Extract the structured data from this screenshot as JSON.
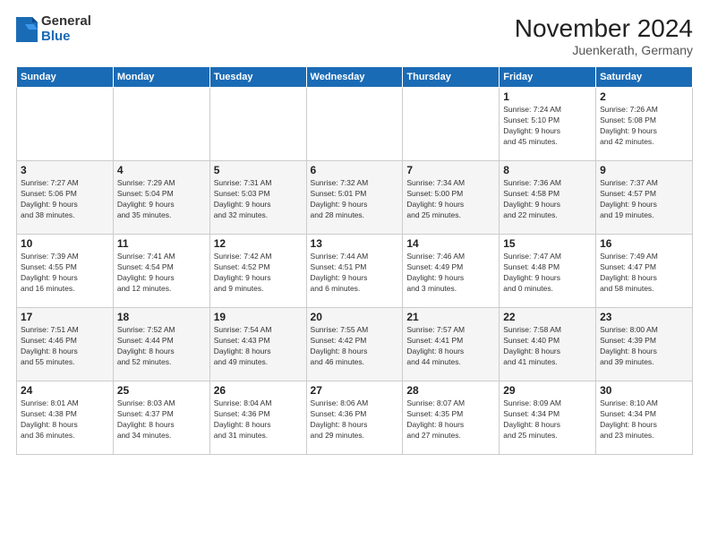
{
  "logo": {
    "general": "General",
    "blue": "Blue"
  },
  "title": "November 2024",
  "location": "Juenkerath, Germany",
  "days_of_week": [
    "Sunday",
    "Monday",
    "Tuesday",
    "Wednesday",
    "Thursday",
    "Friday",
    "Saturday"
  ],
  "weeks": [
    [
      {
        "day": "",
        "info": ""
      },
      {
        "day": "",
        "info": ""
      },
      {
        "day": "",
        "info": ""
      },
      {
        "day": "",
        "info": ""
      },
      {
        "day": "",
        "info": ""
      },
      {
        "day": "1",
        "info": "Sunrise: 7:24 AM\nSunset: 5:10 PM\nDaylight: 9 hours\nand 45 minutes."
      },
      {
        "day": "2",
        "info": "Sunrise: 7:26 AM\nSunset: 5:08 PM\nDaylight: 9 hours\nand 42 minutes."
      }
    ],
    [
      {
        "day": "3",
        "info": "Sunrise: 7:27 AM\nSunset: 5:06 PM\nDaylight: 9 hours\nand 38 minutes."
      },
      {
        "day": "4",
        "info": "Sunrise: 7:29 AM\nSunset: 5:04 PM\nDaylight: 9 hours\nand 35 minutes."
      },
      {
        "day": "5",
        "info": "Sunrise: 7:31 AM\nSunset: 5:03 PM\nDaylight: 9 hours\nand 32 minutes."
      },
      {
        "day": "6",
        "info": "Sunrise: 7:32 AM\nSunset: 5:01 PM\nDaylight: 9 hours\nand 28 minutes."
      },
      {
        "day": "7",
        "info": "Sunrise: 7:34 AM\nSunset: 5:00 PM\nDaylight: 9 hours\nand 25 minutes."
      },
      {
        "day": "8",
        "info": "Sunrise: 7:36 AM\nSunset: 4:58 PM\nDaylight: 9 hours\nand 22 minutes."
      },
      {
        "day": "9",
        "info": "Sunrise: 7:37 AM\nSunset: 4:57 PM\nDaylight: 9 hours\nand 19 minutes."
      }
    ],
    [
      {
        "day": "10",
        "info": "Sunrise: 7:39 AM\nSunset: 4:55 PM\nDaylight: 9 hours\nand 16 minutes."
      },
      {
        "day": "11",
        "info": "Sunrise: 7:41 AM\nSunset: 4:54 PM\nDaylight: 9 hours\nand 12 minutes."
      },
      {
        "day": "12",
        "info": "Sunrise: 7:42 AM\nSunset: 4:52 PM\nDaylight: 9 hours\nand 9 minutes."
      },
      {
        "day": "13",
        "info": "Sunrise: 7:44 AM\nSunset: 4:51 PM\nDaylight: 9 hours\nand 6 minutes."
      },
      {
        "day": "14",
        "info": "Sunrise: 7:46 AM\nSunset: 4:49 PM\nDaylight: 9 hours\nand 3 minutes."
      },
      {
        "day": "15",
        "info": "Sunrise: 7:47 AM\nSunset: 4:48 PM\nDaylight: 9 hours\nand 0 minutes."
      },
      {
        "day": "16",
        "info": "Sunrise: 7:49 AM\nSunset: 4:47 PM\nDaylight: 8 hours\nand 58 minutes."
      }
    ],
    [
      {
        "day": "17",
        "info": "Sunrise: 7:51 AM\nSunset: 4:46 PM\nDaylight: 8 hours\nand 55 minutes."
      },
      {
        "day": "18",
        "info": "Sunrise: 7:52 AM\nSunset: 4:44 PM\nDaylight: 8 hours\nand 52 minutes."
      },
      {
        "day": "19",
        "info": "Sunrise: 7:54 AM\nSunset: 4:43 PM\nDaylight: 8 hours\nand 49 minutes."
      },
      {
        "day": "20",
        "info": "Sunrise: 7:55 AM\nSunset: 4:42 PM\nDaylight: 8 hours\nand 46 minutes."
      },
      {
        "day": "21",
        "info": "Sunrise: 7:57 AM\nSunset: 4:41 PM\nDaylight: 8 hours\nand 44 minutes."
      },
      {
        "day": "22",
        "info": "Sunrise: 7:58 AM\nSunset: 4:40 PM\nDaylight: 8 hours\nand 41 minutes."
      },
      {
        "day": "23",
        "info": "Sunrise: 8:00 AM\nSunset: 4:39 PM\nDaylight: 8 hours\nand 39 minutes."
      }
    ],
    [
      {
        "day": "24",
        "info": "Sunrise: 8:01 AM\nSunset: 4:38 PM\nDaylight: 8 hours\nand 36 minutes."
      },
      {
        "day": "25",
        "info": "Sunrise: 8:03 AM\nSunset: 4:37 PM\nDaylight: 8 hours\nand 34 minutes."
      },
      {
        "day": "26",
        "info": "Sunrise: 8:04 AM\nSunset: 4:36 PM\nDaylight: 8 hours\nand 31 minutes."
      },
      {
        "day": "27",
        "info": "Sunrise: 8:06 AM\nSunset: 4:36 PM\nDaylight: 8 hours\nand 29 minutes."
      },
      {
        "day": "28",
        "info": "Sunrise: 8:07 AM\nSunset: 4:35 PM\nDaylight: 8 hours\nand 27 minutes."
      },
      {
        "day": "29",
        "info": "Sunrise: 8:09 AM\nSunset: 4:34 PM\nDaylight: 8 hours\nand 25 minutes."
      },
      {
        "day": "30",
        "info": "Sunrise: 8:10 AM\nSunset: 4:34 PM\nDaylight: 8 hours\nand 23 minutes."
      }
    ]
  ]
}
